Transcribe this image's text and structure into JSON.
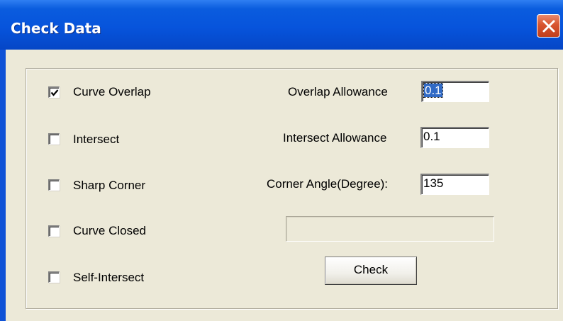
{
  "window": {
    "title": "Check Data",
    "close_icon": "close-x-icon"
  },
  "checks": [
    {
      "label": "Curve Overlap",
      "checked": true
    },
    {
      "label": "Intersect",
      "checked": false
    },
    {
      "label": "Sharp Corner",
      "checked": false
    },
    {
      "label": "Curve Closed",
      "checked": false
    },
    {
      "label": "Self-Intersect",
      "checked": false
    }
  ],
  "fields": {
    "overlap_label": "Overlap Allowance",
    "overlap_value": "0.1",
    "intersect_label": "Intersect Allowance",
    "intersect_value": "0.1",
    "corner_label": "Corner Angle(Degree):",
    "corner_value": "135"
  },
  "progress": {
    "value": 0
  },
  "check_button": {
    "label": "Check"
  },
  "colors": {
    "titlebar": "#0754dc",
    "dialog_face": "#ece9d8",
    "close_button": "#d8542f",
    "selection": "#316ac5"
  }
}
